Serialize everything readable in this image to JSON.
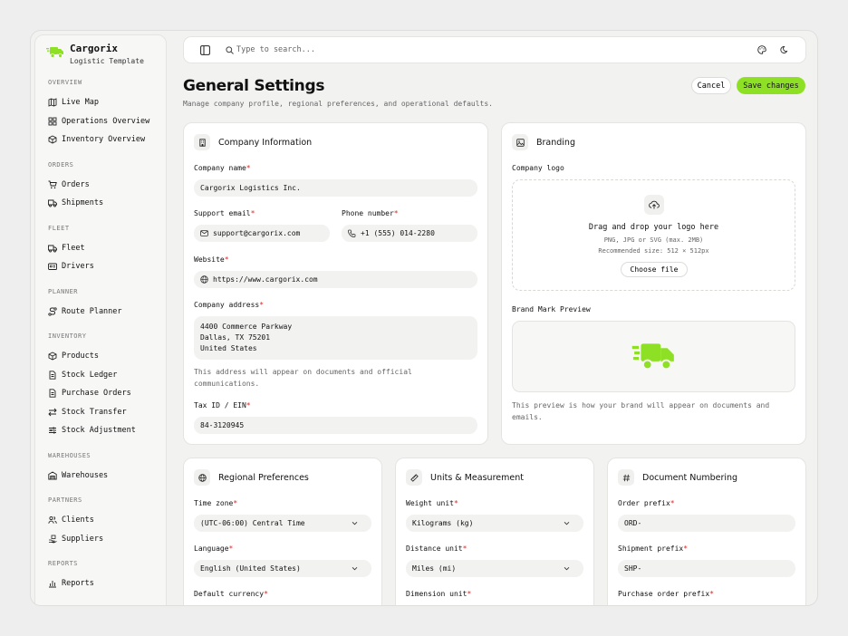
{
  "app": {
    "name": "Cargorix",
    "subtitle": "Logistic Template"
  },
  "colors": {
    "accent": "#8ee025",
    "required": "#e02424"
  },
  "sidebar": {
    "sections": [
      {
        "title": "OVERVIEW",
        "items": [
          {
            "label": "Live Map",
            "icon": "map-icon"
          },
          {
            "label": "Operations Overview",
            "icon": "grid-icon"
          },
          {
            "label": "Inventory Overview",
            "icon": "box-icon"
          }
        ]
      },
      {
        "title": "ORDERS",
        "items": [
          {
            "label": "Orders",
            "icon": "cart-icon"
          },
          {
            "label": "Shipments",
            "icon": "truck-icon"
          }
        ]
      },
      {
        "title": "FLEET",
        "items": [
          {
            "label": "Fleet",
            "icon": "truck-icon"
          },
          {
            "label": "Drivers",
            "icon": "id-card-icon"
          }
        ]
      },
      {
        "title": "PLANNER",
        "items": [
          {
            "label": "Route Planner",
            "icon": "route-icon"
          }
        ]
      },
      {
        "title": "INVENTORY",
        "items": [
          {
            "label": "Products",
            "icon": "box-icon"
          },
          {
            "label": "Stock Ledger",
            "icon": "file-icon"
          },
          {
            "label": "Purchase Orders",
            "icon": "file-icon"
          },
          {
            "label": "Stock Transfer",
            "icon": "transfer-icon"
          },
          {
            "label": "Stock Adjustment",
            "icon": "sliders-icon"
          }
        ]
      },
      {
        "title": "WAREHOUSES",
        "items": [
          {
            "label": "Warehouses",
            "icon": "warehouse-icon"
          }
        ]
      },
      {
        "title": "PARTNERS",
        "items": [
          {
            "label": "Clients",
            "icon": "users-icon"
          },
          {
            "label": "Suppliers",
            "icon": "package-icon"
          }
        ]
      },
      {
        "title": "REPORTS",
        "items": [
          {
            "label": "Reports",
            "icon": "chart-icon"
          }
        ]
      }
    ]
  },
  "topbar": {
    "search_placeholder": "Type to search..."
  },
  "header": {
    "title": "General Settings",
    "subtitle": "Manage company profile, regional preferences, and operational defaults.",
    "cancel_label": "Cancel",
    "save_label": "Save changes"
  },
  "company": {
    "title": "Company Information",
    "name_label": "Company name",
    "name_value": "Cargorix Logistics Inc.",
    "email_label": "Support email",
    "email_value": "support@cargorix.com",
    "phone_label": "Phone number",
    "phone_value": "+1 (555) 014-2280",
    "website_label": "Website",
    "website_value": "https://www.cargorix.com",
    "address_label": "Company address",
    "address_line1": "4400 Commerce Parkway",
    "address_line2": "Dallas, TX 75201",
    "address_line3": "United States",
    "address_hint_1": "This address will appear on documents and official",
    "address_hint_2": "communications.",
    "tax_label": "Tax ID / EIN",
    "tax_value": "84-3120945"
  },
  "branding": {
    "title": "Branding",
    "logo_label": "Company logo",
    "drop_title": "Drag and drop your logo here",
    "drop_formats": "PNG, JPG or SVG (max. 2MB)",
    "drop_size": "Recommended size: 512 × 512px",
    "choose_label": "Choose file",
    "preview_label": "Brand Mark Preview",
    "preview_hint_1": "This preview is how your brand will appear on documents and",
    "preview_hint_2": "emails."
  },
  "regional": {
    "title": "Regional Preferences",
    "timezone_label": "Time zone",
    "timezone_value": "(UTC-06:00) Central Time",
    "language_label": "Language",
    "language_value": "English (United States)",
    "currency_label": "Default currency"
  },
  "units": {
    "title": "Units & Measurement",
    "weight_label": "Weight unit",
    "weight_value": "Kilograms (kg)",
    "distance_label": "Distance unit",
    "distance_value": "Miles (mi)",
    "dimension_label": "Dimension unit"
  },
  "numbering": {
    "title": "Document Numbering",
    "order_label": "Order prefix",
    "order_value": "ORD-",
    "shipment_label": "Shipment prefix",
    "shipment_value": "SHP-",
    "po_label": "Purchase order prefix"
  }
}
